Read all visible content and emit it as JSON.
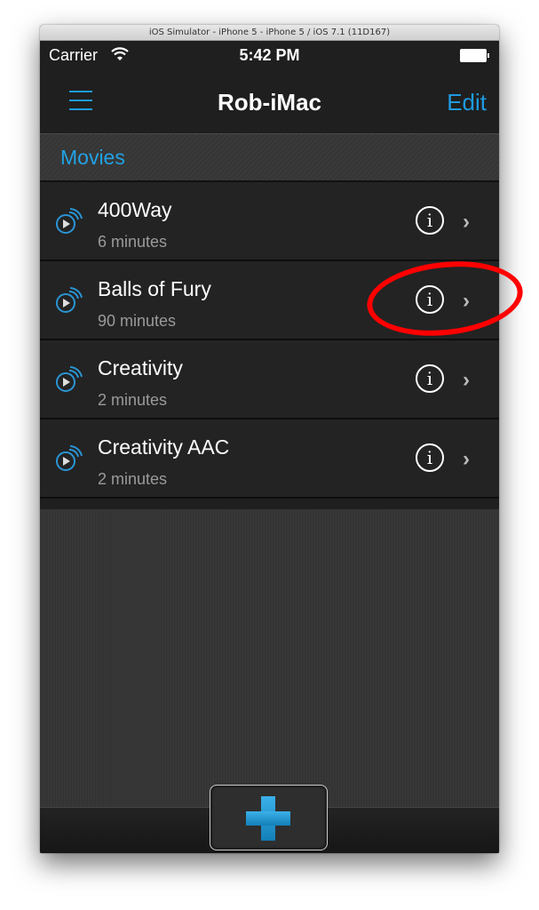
{
  "window": {
    "title": "iOS Simulator - iPhone 5 - iPhone 5 / iOS 7.1 (11D167)"
  },
  "statusbar": {
    "carrier": "Carrier",
    "time": "5:42 PM"
  },
  "navbar": {
    "title": "Rob-iMac",
    "edit_label": "Edit",
    "menu_icon": "hamburger-menu-icon"
  },
  "section": {
    "title": "Movies"
  },
  "movies": [
    {
      "title": "400Way",
      "duration": "6 minutes"
    },
    {
      "title": "Balls of Fury",
      "duration": "90 minutes"
    },
    {
      "title": "Creativity",
      "duration": "2 minutes"
    },
    {
      "title": "Creativity AAC",
      "duration": "2 minutes"
    }
  ],
  "row_controls": {
    "info_glyph": "i",
    "chevron_glyph": "›"
  },
  "bottombar": {
    "add_label": "Add a movie"
  },
  "colors": {
    "accent": "#1e9be0",
    "annotation": "#ff0000"
  }
}
